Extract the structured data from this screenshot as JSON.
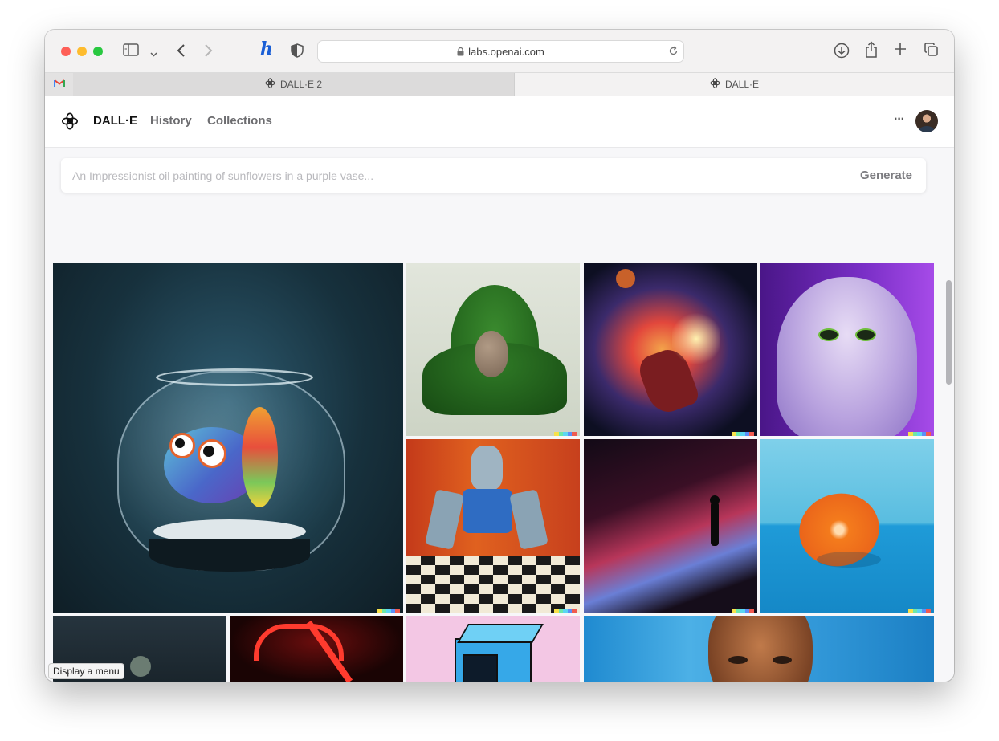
{
  "browser": {
    "url": "labs.openai.com",
    "tabs": [
      {
        "label": "DALL·E 2",
        "active": false
      },
      {
        "label": "DALL·E",
        "active": true
      }
    ],
    "pinned_tab_icon": "gmail-icon"
  },
  "nav": {
    "brand": "DALL·E",
    "history_label": "History",
    "collections_label": "Collections",
    "more_label": "···"
  },
  "prompt": {
    "placeholder": "An Impressionist oil painting of sunflowers in a purple vase...",
    "value": "",
    "button_label": "Generate"
  },
  "gallery": [
    {
      "subject": "glass fishbowl with rainbow fish"
    },
    {
      "subject": "avocado armchair"
    },
    {
      "subject": "basketball player dunking in cosmic explosion"
    },
    {
      "subject": "fluffy purple monster"
    },
    {
      "subject": "robot playing chess, oil painting"
    },
    {
      "subject": "person on glowing wave ridge"
    },
    {
      "subject": "halved orange on blue"
    },
    {
      "subject": "astronaut in dark room"
    },
    {
      "subject": "red neon light"
    },
    {
      "subject": "blue isometric computer on pink"
    },
    {
      "subject": "painted portrait against blue sky"
    }
  ],
  "tooltip": "Display a menu",
  "colors": {
    "close": "#fe5f57",
    "minimize": "#febc2e",
    "zoom": "#28c840",
    "accent": "#1a5fd6"
  }
}
